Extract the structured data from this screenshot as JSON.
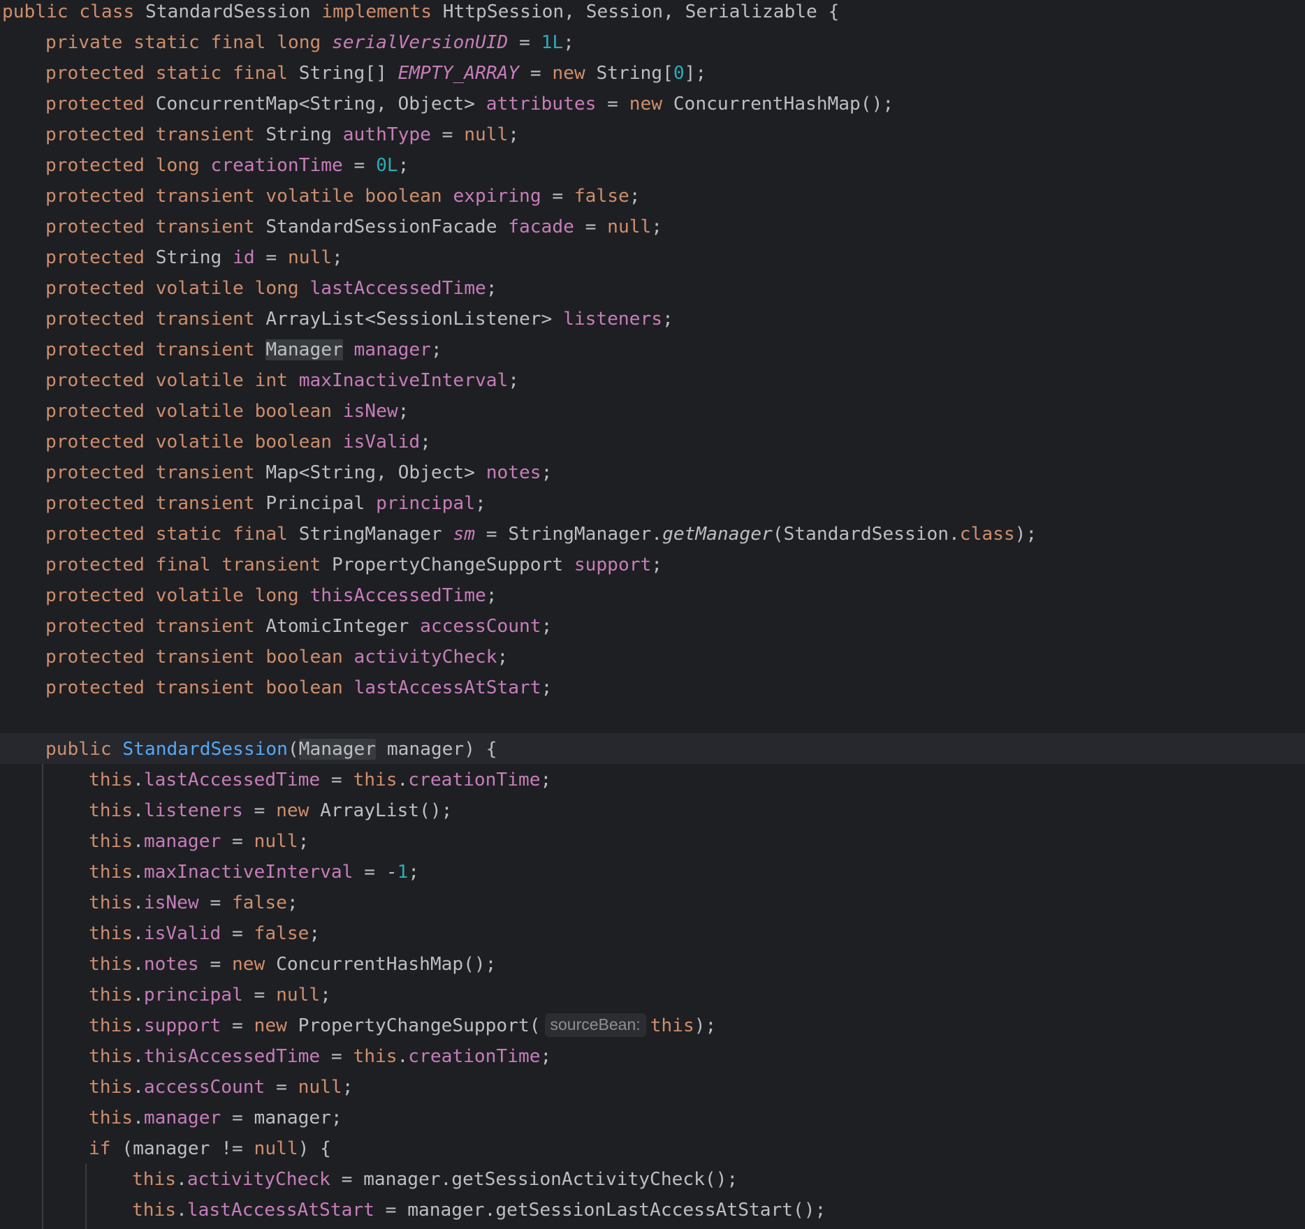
{
  "editor": {
    "language": "Java",
    "class_declaration": {
      "public_kw": "public",
      "class_kw": "class",
      "class_name": "StandardSession",
      "implements_kw": "implements",
      "interfaces": "HttpSession, Session, Serializable",
      "open_brace": "{"
    },
    "tokens": {
      "public": "public",
      "private": "private",
      "protected": "protected",
      "static": "static",
      "final": "final",
      "transient": "transient",
      "volatile": "volatile",
      "long": "long",
      "int": "int",
      "boolean": "boolean",
      "new": "new",
      "null": "null",
      "false": "false",
      "this": "this",
      "if": "if",
      "class": "class"
    },
    "fields": {
      "serialVersionUID": "serialVersionUID",
      "EMPTY_ARRAY": "EMPTY_ARRAY",
      "attributes": "attributes",
      "authType": "authType",
      "creationTime": "creationTime",
      "expiring": "expiring",
      "facade": "facade",
      "id": "id",
      "lastAccessedTime": "lastAccessedTime",
      "listeners": "listeners",
      "manager": "manager",
      "maxInactiveInterval": "maxInactiveInterval",
      "isNew": "isNew",
      "isValid": "isValid",
      "notes": "notes",
      "principal": "principal",
      "sm": "sm",
      "support": "support",
      "thisAccessedTime": "thisAccessedTime",
      "accessCount": "accessCount",
      "activityCheck": "activityCheck",
      "lastAccessAtStart": "lastAccessAtStart"
    },
    "types": {
      "String": "String",
      "String_array": "String[]",
      "ConcurrentMap_generic": "ConcurrentMap<String, Object>",
      "ConcurrentHashMap_ctor": "ConcurrentHashMap();",
      "StandardSessionFacade": "StandardSessionFacade",
      "ArrayList_generic": "ArrayList<SessionListener>",
      "Manager": "Manager",
      "Map_generic": "Map<String, Object>",
      "Principal": "Principal",
      "StringManager": "StringManager",
      "PropertyChangeSupport": "PropertyChangeSupport",
      "AtomicInteger": "AtomicInteger",
      "ArrayList_ctor": "ArrayList();",
      "PropertyChangeSupport_ctor": "PropertyChangeSupport("
    },
    "numbers": {
      "one_L": "1L",
      "zero": "0",
      "zero_L": "0L",
      "minus_one": "1"
    },
    "constructor": {
      "name": "StandardSession",
      "param_name": "manager"
    },
    "calls": {
      "getManager": "getManager",
      "getSessionActivityCheck": "manager.getSessionActivityCheck();",
      "getSessionLastAccessAtStart": "manager.getSessionLastAccessAtStart();"
    },
    "inlay_hint": {
      "sourceBean": "sourceBean:"
    }
  }
}
